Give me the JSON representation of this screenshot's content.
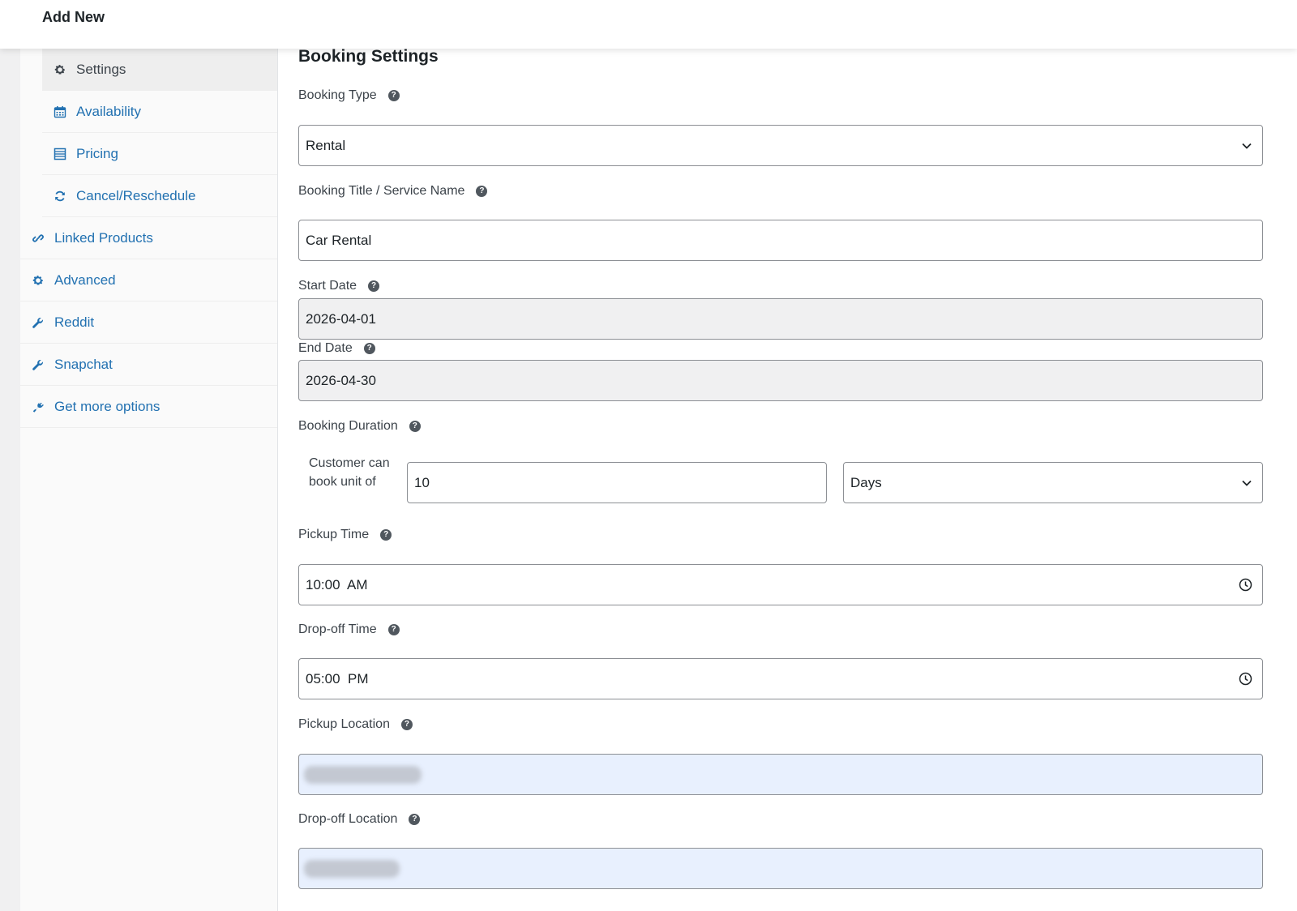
{
  "topbar": {
    "title": "Add New"
  },
  "sidebar": {
    "items": [
      {
        "label": "Settings",
        "icon": "gear-icon"
      },
      {
        "label": "Availability",
        "icon": "calendar-icon"
      },
      {
        "label": "Pricing",
        "icon": "table-icon"
      },
      {
        "label": "Cancel/Reschedule",
        "icon": "refresh-icon"
      },
      {
        "label": "Linked Products",
        "icon": "link-icon"
      },
      {
        "label": "Advanced",
        "icon": "gear-icon"
      },
      {
        "label": "Reddit",
        "icon": "wrench-icon"
      },
      {
        "label": "Snapchat",
        "icon": "wrench-icon"
      },
      {
        "label": "Get more options",
        "icon": "plugin-icon"
      }
    ]
  },
  "form": {
    "heading": "Booking Settings",
    "booking_type": {
      "label": "Booking Type",
      "value": "Rental"
    },
    "booking_title": {
      "label": "Booking Title / Service Name",
      "value": "Car Rental"
    },
    "start_date": {
      "label": "Start Date",
      "value": "2026-04-01"
    },
    "end_date": {
      "label": "End Date",
      "value": "2026-04-30"
    },
    "booking_duration": {
      "label": "Booking Duration",
      "unit_label": "Customer can book unit of",
      "value": "10",
      "unit": "Days"
    },
    "pickup_time": {
      "label": "Pickup Time",
      "value": "10:00  AM"
    },
    "dropoff_time": {
      "label": "Drop-off Time",
      "value": "05:00  PM"
    },
    "pickup_location": {
      "label": "Pickup Location"
    },
    "dropoff_location": {
      "label": "Drop-off Location"
    },
    "help_glyph": "?",
    "colors": {
      "link": "#2271b1",
      "location_bg": "#e8f0fe",
      "readonly_bg": "#f0f0f1"
    }
  }
}
